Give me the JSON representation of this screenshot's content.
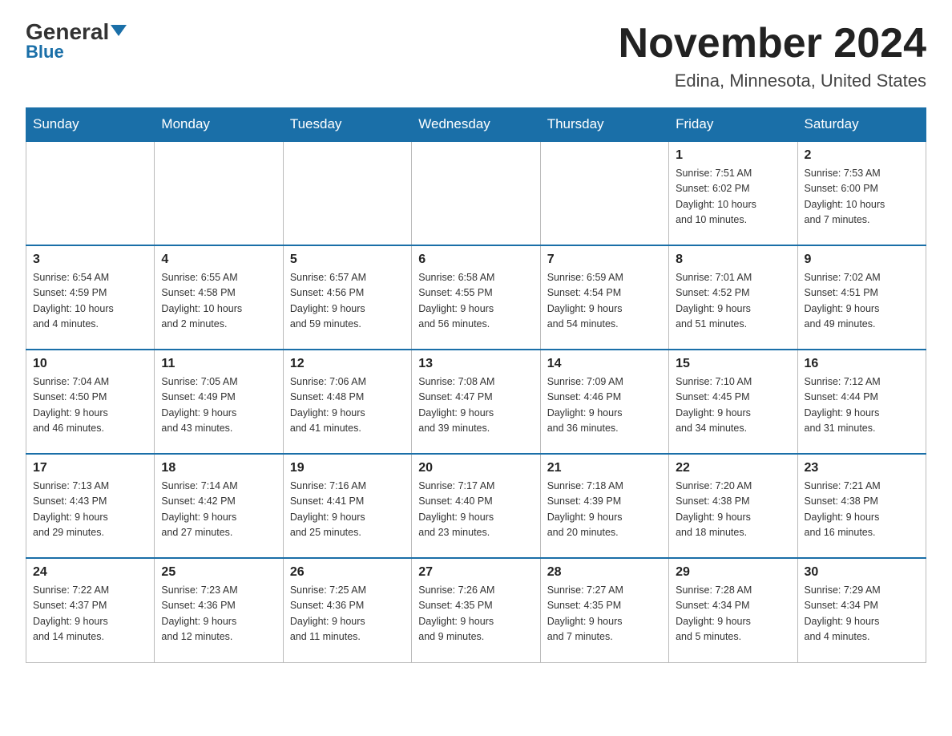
{
  "header": {
    "logo_text": "General",
    "logo_blue": "Blue",
    "month": "November 2024",
    "location": "Edina, Minnesota, United States"
  },
  "days_of_week": [
    "Sunday",
    "Monday",
    "Tuesday",
    "Wednesday",
    "Thursday",
    "Friday",
    "Saturday"
  ],
  "weeks": [
    [
      {
        "day": "",
        "info": ""
      },
      {
        "day": "",
        "info": ""
      },
      {
        "day": "",
        "info": ""
      },
      {
        "day": "",
        "info": ""
      },
      {
        "day": "",
        "info": ""
      },
      {
        "day": "1",
        "info": "Sunrise: 7:51 AM\nSunset: 6:02 PM\nDaylight: 10 hours\nand 10 minutes."
      },
      {
        "day": "2",
        "info": "Sunrise: 7:53 AM\nSunset: 6:00 PM\nDaylight: 10 hours\nand 7 minutes."
      }
    ],
    [
      {
        "day": "3",
        "info": "Sunrise: 6:54 AM\nSunset: 4:59 PM\nDaylight: 10 hours\nand 4 minutes."
      },
      {
        "day": "4",
        "info": "Sunrise: 6:55 AM\nSunset: 4:58 PM\nDaylight: 10 hours\nand 2 minutes."
      },
      {
        "day": "5",
        "info": "Sunrise: 6:57 AM\nSunset: 4:56 PM\nDaylight: 9 hours\nand 59 minutes."
      },
      {
        "day": "6",
        "info": "Sunrise: 6:58 AM\nSunset: 4:55 PM\nDaylight: 9 hours\nand 56 minutes."
      },
      {
        "day": "7",
        "info": "Sunrise: 6:59 AM\nSunset: 4:54 PM\nDaylight: 9 hours\nand 54 minutes."
      },
      {
        "day": "8",
        "info": "Sunrise: 7:01 AM\nSunset: 4:52 PM\nDaylight: 9 hours\nand 51 minutes."
      },
      {
        "day": "9",
        "info": "Sunrise: 7:02 AM\nSunset: 4:51 PM\nDaylight: 9 hours\nand 49 minutes."
      }
    ],
    [
      {
        "day": "10",
        "info": "Sunrise: 7:04 AM\nSunset: 4:50 PM\nDaylight: 9 hours\nand 46 minutes."
      },
      {
        "day": "11",
        "info": "Sunrise: 7:05 AM\nSunset: 4:49 PM\nDaylight: 9 hours\nand 43 minutes."
      },
      {
        "day": "12",
        "info": "Sunrise: 7:06 AM\nSunset: 4:48 PM\nDaylight: 9 hours\nand 41 minutes."
      },
      {
        "day": "13",
        "info": "Sunrise: 7:08 AM\nSunset: 4:47 PM\nDaylight: 9 hours\nand 39 minutes."
      },
      {
        "day": "14",
        "info": "Sunrise: 7:09 AM\nSunset: 4:46 PM\nDaylight: 9 hours\nand 36 minutes."
      },
      {
        "day": "15",
        "info": "Sunrise: 7:10 AM\nSunset: 4:45 PM\nDaylight: 9 hours\nand 34 minutes."
      },
      {
        "day": "16",
        "info": "Sunrise: 7:12 AM\nSunset: 4:44 PM\nDaylight: 9 hours\nand 31 minutes."
      }
    ],
    [
      {
        "day": "17",
        "info": "Sunrise: 7:13 AM\nSunset: 4:43 PM\nDaylight: 9 hours\nand 29 minutes."
      },
      {
        "day": "18",
        "info": "Sunrise: 7:14 AM\nSunset: 4:42 PM\nDaylight: 9 hours\nand 27 minutes."
      },
      {
        "day": "19",
        "info": "Sunrise: 7:16 AM\nSunset: 4:41 PM\nDaylight: 9 hours\nand 25 minutes."
      },
      {
        "day": "20",
        "info": "Sunrise: 7:17 AM\nSunset: 4:40 PM\nDaylight: 9 hours\nand 23 minutes."
      },
      {
        "day": "21",
        "info": "Sunrise: 7:18 AM\nSunset: 4:39 PM\nDaylight: 9 hours\nand 20 minutes."
      },
      {
        "day": "22",
        "info": "Sunrise: 7:20 AM\nSunset: 4:38 PM\nDaylight: 9 hours\nand 18 minutes."
      },
      {
        "day": "23",
        "info": "Sunrise: 7:21 AM\nSunset: 4:38 PM\nDaylight: 9 hours\nand 16 minutes."
      }
    ],
    [
      {
        "day": "24",
        "info": "Sunrise: 7:22 AM\nSunset: 4:37 PM\nDaylight: 9 hours\nand 14 minutes."
      },
      {
        "day": "25",
        "info": "Sunrise: 7:23 AM\nSunset: 4:36 PM\nDaylight: 9 hours\nand 12 minutes."
      },
      {
        "day": "26",
        "info": "Sunrise: 7:25 AM\nSunset: 4:36 PM\nDaylight: 9 hours\nand 11 minutes."
      },
      {
        "day": "27",
        "info": "Sunrise: 7:26 AM\nSunset: 4:35 PM\nDaylight: 9 hours\nand 9 minutes."
      },
      {
        "day": "28",
        "info": "Sunrise: 7:27 AM\nSunset: 4:35 PM\nDaylight: 9 hours\nand 7 minutes."
      },
      {
        "day": "29",
        "info": "Sunrise: 7:28 AM\nSunset: 4:34 PM\nDaylight: 9 hours\nand 5 minutes."
      },
      {
        "day": "30",
        "info": "Sunrise: 7:29 AM\nSunset: 4:34 PM\nDaylight: 9 hours\nand 4 minutes."
      }
    ]
  ]
}
